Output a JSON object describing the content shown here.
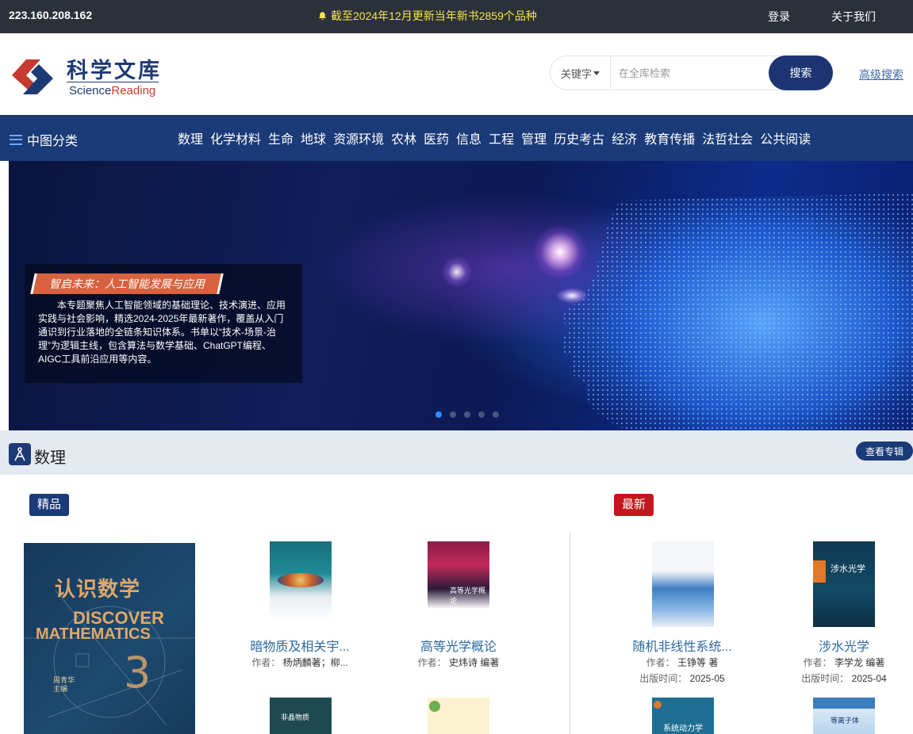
{
  "topbar": {
    "ip": "223.160.208.162",
    "notice": "截至2024年12月更新当年新书2859个品种",
    "login": "登录",
    "about": "关于我们"
  },
  "header": {
    "logo_cn": "科学文库",
    "logo_en_a": "Science",
    "logo_en_b": "Reading",
    "logo_en_c": "",
    "search_type": "关键字",
    "search_placeholder": "在全库检索",
    "search_button": "搜索",
    "advanced": "高级搜索"
  },
  "nav": {
    "classify": "中图分类",
    "items": [
      "数理",
      "化学材料",
      "生命",
      "地球",
      "资源环境",
      "农林",
      "医药",
      "信息",
      "工程",
      "管理",
      "历史考古",
      "经济",
      "教育传播",
      "法哲社会",
      "公共阅读"
    ]
  },
  "banner": {
    "title": "智启未来：人工智能发展与应用",
    "description": "本专题聚焦人工智能领域的基础理论、技术演进、应用实践与社会影响，精选2024-2025年最新著作，覆盖从入门通识到行业落地的全链条知识体系。书单以“技术-场景-治理”为逻辑主线，包含算法与数学基础、ChatGPT编程、AIGC工具前沿应用等内容。",
    "active_slide": 1,
    "slide_count": 5
  },
  "section": {
    "title": "数理",
    "more": "查看专辑",
    "featured_label": "精品",
    "latest_label": "最新",
    "featured_cover": {
      "title_cn": "认识数学",
      "title_en_1": "DISCOVER",
      "title_en_2": "MATHEMATICS",
      "volume": "3",
      "editor_1": "周青华",
      "editor_2": "主编"
    },
    "books": [
      {
        "name": "暗物质及相关宇...",
        "author_label": "作者：",
        "author": "杨炳麟著；柳..."
      },
      {
        "name": "高等光学概论",
        "author_label": "作者：",
        "author": "史炜诗 编著"
      },
      {
        "name": "随机非线性系统...",
        "author_label": "作者：",
        "author": "王铮等 著",
        "date_label": "出版时间：",
        "date": "2025-05"
      },
      {
        "name": "涉水光学",
        "author_label": "作者：",
        "author": "李学龙 编著",
        "date_label": "出版时间：",
        "date": "2025-04"
      }
    ],
    "row2_covers": [
      "非晶物质",
      "",
      "系统动力学",
      "等离子体"
    ]
  },
  "colors": {
    "topbar": "#2b3139",
    "nav": "#1b3a78",
    "accent_red": "#c4161c",
    "link": "#2c6aa0"
  }
}
